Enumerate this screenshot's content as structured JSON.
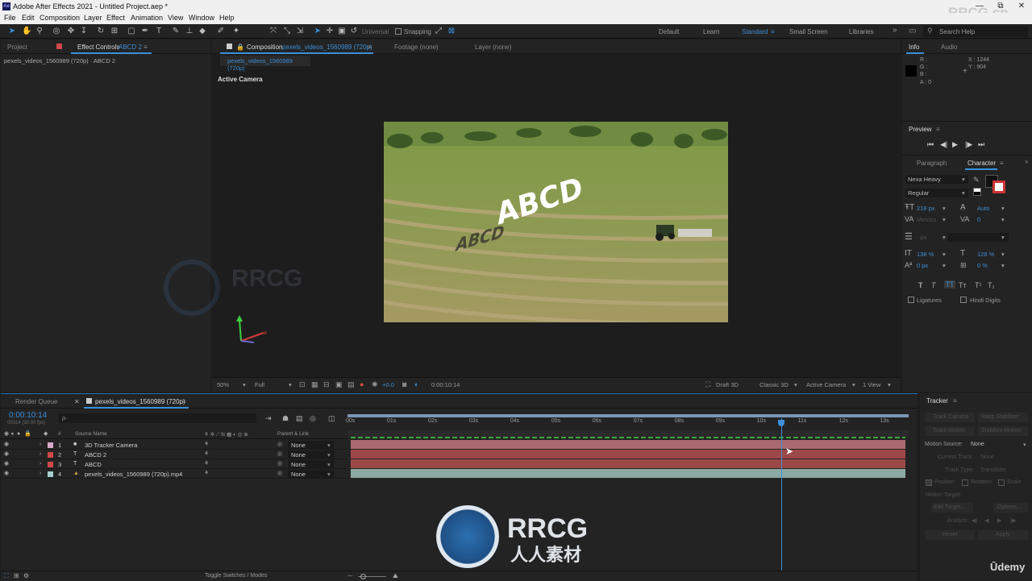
{
  "title_bar": {
    "app_icon": "Ae",
    "title": "Adobe After Effects 2021 - Untitled Project.aep *",
    "minimize": "—",
    "maximize": "⧉",
    "close": "✕"
  },
  "menu": [
    "File",
    "Edit",
    "Composition",
    "Layer",
    "Effect",
    "Animation",
    "View",
    "Window",
    "Help"
  ],
  "toolbar": {
    "universal": "Universal",
    "snapping": "Snapping",
    "workspaces": [
      "Default",
      "Learn",
      "Standard",
      "Small Screen",
      "Libraries"
    ],
    "active_workspace": "Standard",
    "more": "»",
    "search_placeholder": "Search Help"
  },
  "project_panel": {
    "tab_project": "Project",
    "tab_effect_controls": "Effect Controls",
    "effect_layer": "ABCD 2",
    "breadcrumb": "pexels_videos_1560989 (720p) · ABCD 2"
  },
  "comp_panel": {
    "tab_composition": "Composition",
    "comp_name": "pexels_videos_1560989 (720p)",
    "tab_footage": "Footage (none)",
    "tab_layer": "Layer (none)",
    "subtab": "pexels_videos_1560989 (720p)",
    "camera_label": "Active Camera",
    "text_3d": "ABCD",
    "footer": {
      "zoom": "50%",
      "resolution": "Full",
      "exposure": "+0.0",
      "timecode": "0:00:10:14",
      "draft": "Draft 3D",
      "renderer": "Classic 3D",
      "camera": "Active Camera",
      "views": "1 View"
    }
  },
  "info_panel": {
    "tab_info": "Info",
    "tab_audio": "Audio",
    "r": "R :",
    "g": "G :",
    "b": "B :",
    "a": "A : 0",
    "x": "X : 1244",
    "y": "Y : 904"
  },
  "preview_panel": {
    "title": "Preview",
    "buttons": [
      "⏮",
      "◀|",
      "▶",
      "|▶",
      "⏭"
    ]
  },
  "character_panel": {
    "tab_paragraph": "Paragraph",
    "tab_character": "Character",
    "font": "Nexa Heavy",
    "style": "Regular",
    "font_size": "218 px",
    "leading": "Auto",
    "kerning": "Metrics",
    "tracking": "0",
    "stroke": "- px",
    "vscale": "138 %",
    "hscale": "128 %",
    "baseline": "0 px",
    "tsume": "0 %",
    "text_styles": [
      "T",
      "T",
      "TT",
      "Tт",
      "T¹",
      "T₁"
    ],
    "ligatures": "Ligatures",
    "hindi_digits": "Hindi Digits"
  },
  "timeline": {
    "tab_render_queue": "Render Queue",
    "tab_comp": "pexels_videos_1560989 (720p)",
    "timecode": "0:00:10:14",
    "frames": "00314 (30.00 fps)",
    "search_placeholder": "ρ·",
    "col_source": "Source Name",
    "col_parent": "Parent & Link",
    "hash": "#",
    "layers": [
      {
        "num": "1",
        "type": "camera",
        "name": "3D Tracker Camera",
        "parent": "None",
        "label_color": "#d8a8c8"
      },
      {
        "num": "2",
        "type": "text",
        "name": "ABCD 2",
        "parent": "None",
        "label_color": "#d0484a"
      },
      {
        "num": "3",
        "type": "text",
        "name": "ABCD",
        "parent": "None",
        "label_color": "#d0484a"
      },
      {
        "num": "4",
        "type": "footage",
        "name": "pexels_videos_1560989 (720p).mp4",
        "parent": "None",
        "label_color": "#a8cfcf"
      }
    ],
    "ruler": [
      "00s",
      "01s",
      "02s",
      "03s",
      "04s",
      "05s",
      "06s",
      "07s",
      "08s",
      "09s",
      "10s",
      "11s",
      "12s",
      "13s"
    ],
    "playhead_seconds": 10.47,
    "duration_seconds": 13.5,
    "footer_toggle": "Toggle Switches / Modes"
  },
  "tracker_panel": {
    "title": "Tracker",
    "track_camera": "Track Camera",
    "warp_stabilizer": "Warp Stabilizer",
    "track_motion": "Track Motion",
    "stabilize_motion": "Stabilize Motion",
    "motion_source_label": "Motion Source:",
    "motion_source": "None",
    "current_track_label": "Current Track:",
    "current_track": "None",
    "track_type_label": "Track Type:",
    "track_type": "Transform",
    "position": "Position",
    "rotation": "Rotation",
    "scale": "Scale",
    "motion_target": "Motion Target:",
    "edit_target": "Edit Target...",
    "options": "Options...",
    "analyze": "Analyze:",
    "reset": "Reset",
    "apply": "Apply"
  },
  "watermarks": {
    "top_right": "RRCG.cn",
    "center_big": "RRCG",
    "center_sub": "人人素材",
    "udemy": "Ūdemy"
  },
  "colors": {
    "accent": "#3b8fd9",
    "panel_bg": "#232323",
    "text_layer_bar": "#9c4848",
    "camera_layer_bar": "#a86a70",
    "footage_layer_bar": "#8ba9a3",
    "keyframe_green": "#3aa83a"
  }
}
